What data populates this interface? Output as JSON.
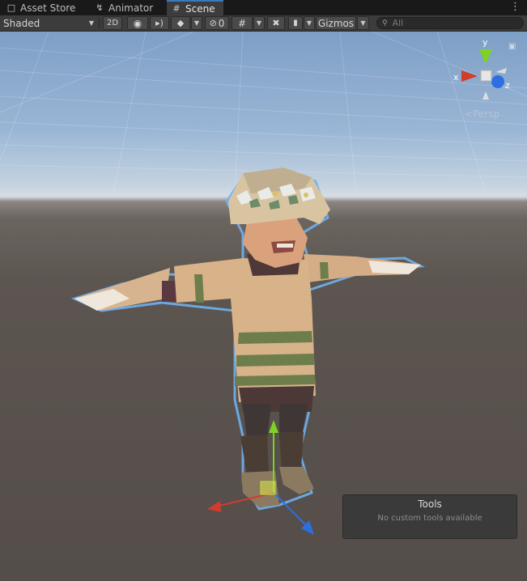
{
  "tabs": [
    {
      "label": "Asset Store",
      "icon": "shopping-bag-icon",
      "active": false
    },
    {
      "label": "Animator",
      "icon": "animator-icon",
      "active": false
    },
    {
      "label": "Scene",
      "icon": "grid-hash-icon",
      "active": true
    }
  ],
  "toolbar": {
    "shading_mode": "Shaded",
    "mode_2d_label": "2D",
    "hidden_count": "0",
    "gizmos_label": "Gizmos",
    "search_placeholder": "All"
  },
  "scene_gizmo": {
    "y_label": "y",
    "x_label": "x",
    "z_label": "z",
    "projection_label": "Persp"
  },
  "tools_overlay": {
    "title": "Tools",
    "message": "No custom tools available"
  },
  "colors": {
    "accent": "#3a79bb",
    "axis_x": "#d33b2c",
    "axis_y": "#7ed321",
    "axis_z": "#2d6fe0",
    "selection_outline": "#5aa0e8"
  }
}
